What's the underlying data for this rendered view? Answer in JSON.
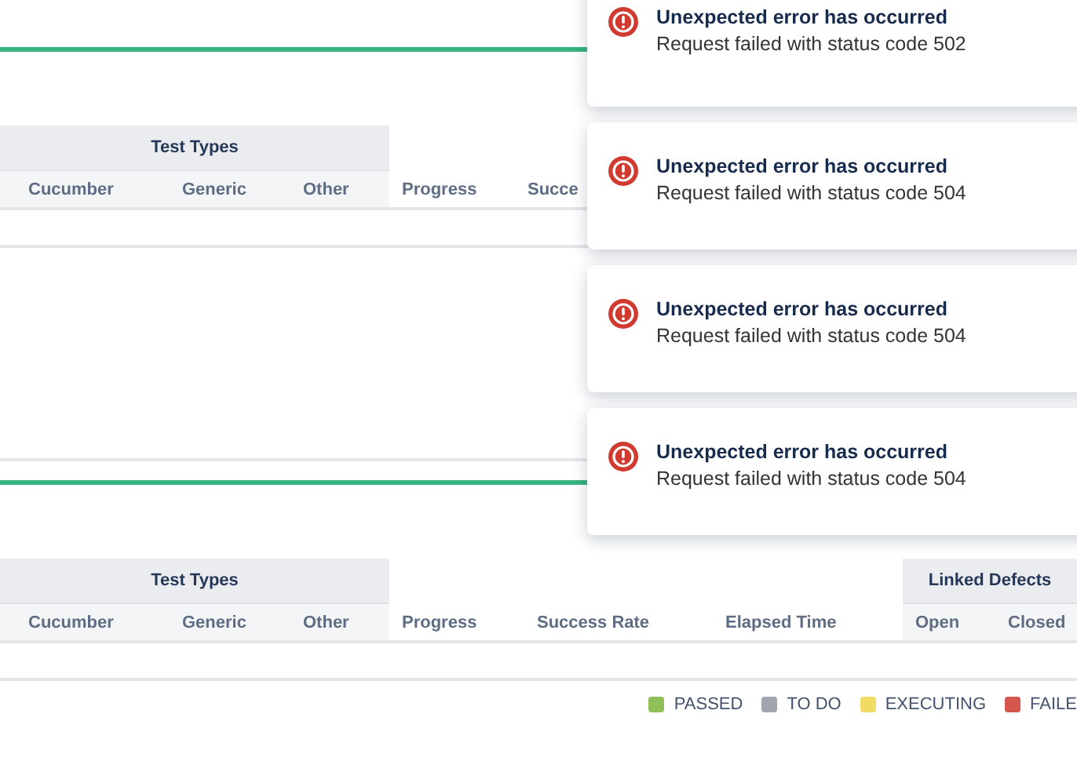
{
  "sections": [
    {
      "column_groups": [
        {
          "label": "Test Types"
        }
      ],
      "columns": [
        "Cucumber",
        "Generic",
        "Other",
        "Progress",
        "Succe"
      ]
    },
    {
      "column_groups": [
        {
          "label": "Test Types"
        },
        {
          "label": "Linked Defects"
        }
      ],
      "columns": [
        "Cucumber",
        "Generic",
        "Other",
        "Progress",
        "Success Rate",
        "Elapsed Time",
        "Open",
        "Closed"
      ],
      "legend": [
        {
          "label": "PASSED",
          "color": "#8fbf58"
        },
        {
          "label": "TO DO",
          "color": "#a0a5ae"
        },
        {
          "label": "EXECUTING",
          "color": "#f0dc63"
        },
        {
          "label": "FAILE",
          "color": "#d5564c"
        }
      ]
    }
  ],
  "toasts": [
    {
      "title": "Unexpected error has occurred",
      "message": "Request failed with status code 502"
    },
    {
      "title": "Unexpected error has occurred",
      "message": "Request failed with status code 504"
    },
    {
      "title": "Unexpected error has occurred",
      "message": "Request failed with status code 504"
    },
    {
      "title": "Unexpected error has occurred",
      "message": "Request failed with status code 504"
    }
  ]
}
